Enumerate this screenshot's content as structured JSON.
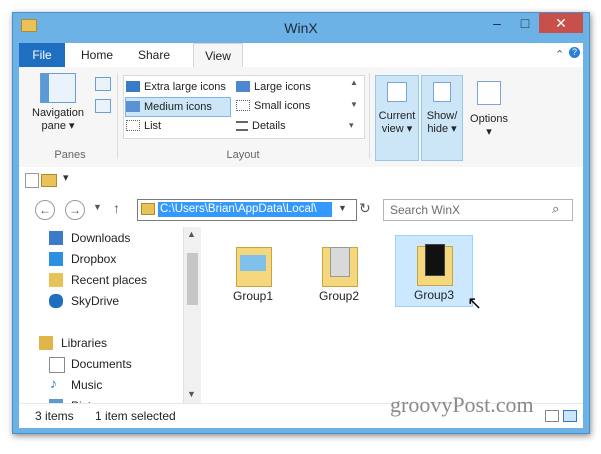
{
  "window": {
    "title": "WinX"
  },
  "ribbon": {
    "tabs": [
      {
        "label": "File"
      },
      {
        "label": "Home"
      },
      {
        "label": "Share"
      },
      {
        "label": "View"
      }
    ],
    "panes": {
      "navigation_pane": "Navigation\npane ▾",
      "group_label": "Panes"
    },
    "layout": {
      "group_label": "Layout",
      "options": [
        "Extra large icons",
        "Large icons",
        "Medium icons",
        "Small icons",
        "List",
        "Details"
      ],
      "selected": "Medium icons"
    },
    "current_view": "Current\nview ▾",
    "show_hide": "Show/\nhide ▾",
    "options_btn": "Options\n▾"
  },
  "address": {
    "path": "C:\\Users\\Brian\\AppData\\Local\\",
    "search_placeholder": "Search WinX"
  },
  "nav_pane": {
    "items": [
      "Downloads",
      "Dropbox",
      "Recent places",
      "SkyDrive",
      "Libraries",
      "Documents",
      "Music",
      "Pictures"
    ]
  },
  "files": [
    {
      "name": "Group1"
    },
    {
      "name": "Group2"
    },
    {
      "name": "Group3"
    }
  ],
  "status": {
    "count": "3 items",
    "selection": "1 item selected"
  },
  "watermark": "groovyPost.com",
  "colors": {
    "accent": "#1f6fc0",
    "selection": "#cce8ff",
    "titlebar": "#6db2e6"
  }
}
